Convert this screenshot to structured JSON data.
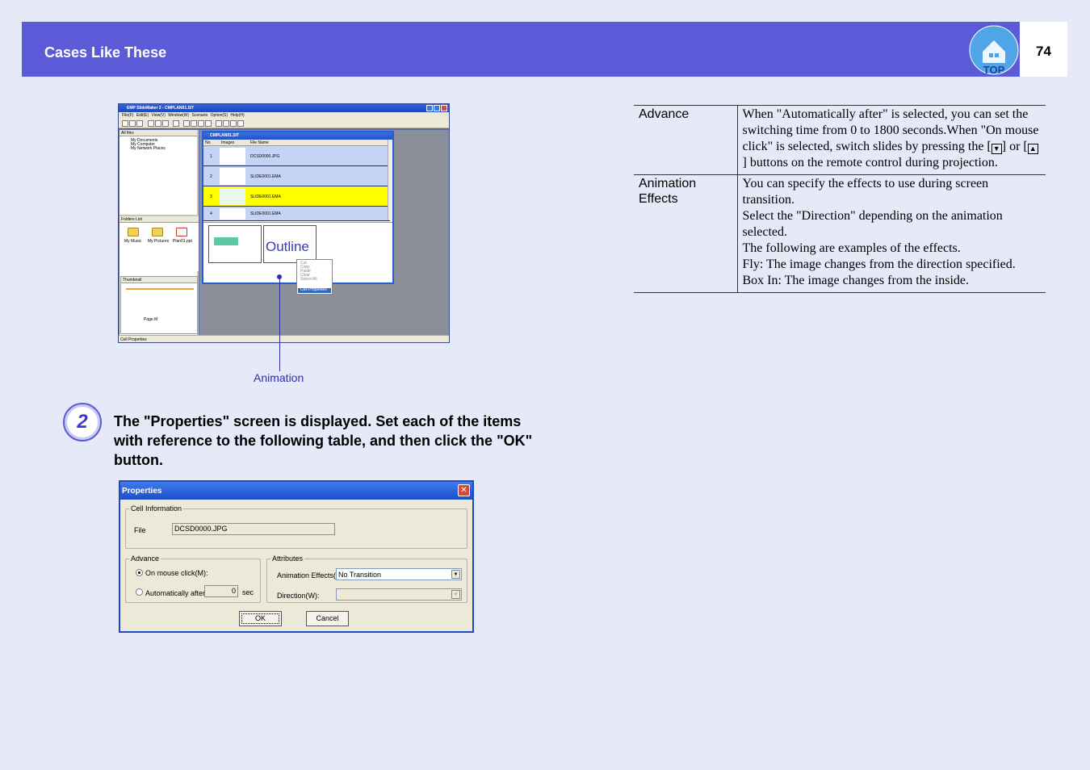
{
  "header": {
    "title": "Cases Like These",
    "page_number": "74",
    "top_label": "TOP"
  },
  "screenshot1": {
    "window_title": "EMP SlideMaker 2 - CMPLAN01.SIT",
    "menu": "File(F)  Edit(E)  View(V)  Window(W)  Scenario Option(S)  Help(H)",
    "left_header": "All files",
    "tree": [
      "My Documents",
      "My Computer",
      "My Network Places"
    ],
    "folders_header": "Folders List",
    "folders": [
      "My Music",
      "My Pictures",
      "Plan01.ppt"
    ],
    "thumbnail_header": "Thumbnail",
    "thumbnail_page": "Page.M",
    "inner_title": "CMPLAN01.SIT",
    "columns": [
      "No.",
      "Images",
      "File Name"
    ],
    "rows": [
      {
        "no": "1",
        "file": "DCSD0000.JPG"
      },
      {
        "no": "2",
        "file": "SLIDE0001.EMA"
      },
      {
        "no": "3",
        "file": "SLIDE0001.EMA"
      },
      {
        "no": "4",
        "file": "SLIDE0001.EMA"
      }
    ],
    "outline_text": "Outline",
    "context_menu": [
      "Cut",
      "Copy",
      "Paste",
      "Clear",
      "Select All",
      "Cell Properties"
    ],
    "status": "Cell Properties",
    "callout_label": "Animation"
  },
  "step": {
    "number": "2",
    "text": "The \"Properties\" screen is displayed. Set each of the items with reference to the following table, and then click the \"OK\" button."
  },
  "dialog": {
    "title": "Properties",
    "close": "✕",
    "cell_info_legend": "Cell Information",
    "file_label": "File",
    "file_value": "DCSD0000.JPG",
    "advance_legend": "Advance",
    "on_mouse_click": "On mouse click(M):",
    "auto_after": "Automatically after(A):",
    "seconds_value": "0",
    "sec_unit": "sec",
    "attributes_legend": "Attributes",
    "animation_effects_label": "Animation Effects(E):",
    "animation_effects_value": "No Transition",
    "direction_label": "Direction(W):",
    "direction_value": "",
    "ok": "OK",
    "cancel": "Cancel"
  },
  "table": {
    "rows": [
      {
        "label": "Advance",
        "lines": [
          "When \"Automatically after\" is selected, you can set the switching time from 0 to 1800 seconds.When \"On mouse click\" is selected, switch slides by pressing the [",
          "] or [",
          "] buttons on the remote control during projection."
        ],
        "key_down": "▼",
        "key_up": "▲"
      },
      {
        "label": "Animation Effects",
        "paragraphs": [
          "You can specify the effects to use during screen transition.",
          "Select the \"Direction\" depending on the animation selected.",
          "The following are examples of the effects.",
          "Fly: The image changes from the direction specified.",
          "Box In: The image changes from the inside."
        ]
      }
    ]
  },
  "colors": {
    "header_bar": "#5b5bd8",
    "background": "#e5e9f8",
    "callout": "#2e2eb0"
  }
}
